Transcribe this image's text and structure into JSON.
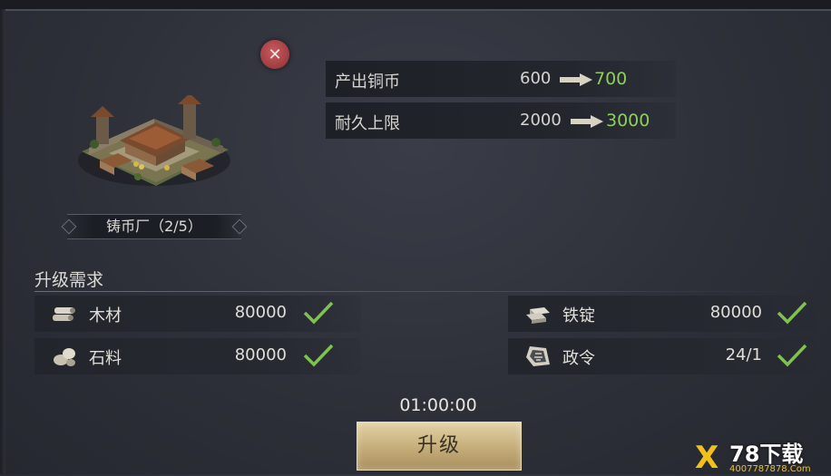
{
  "close_symbol": "✕",
  "building": {
    "name": "铸币厂（2/5）",
    "icon": "mint-building-icon"
  },
  "stats": [
    {
      "label": "产出铜币",
      "old": "600",
      "new": "700"
    },
    {
      "label": "耐久上限",
      "old": "2000",
      "new": "3000"
    }
  ],
  "requirements": {
    "title": "升级需求",
    "items": [
      {
        "name": "木材",
        "amount": "80000",
        "icon": "wood-icon",
        "met": true
      },
      {
        "name": "铁锭",
        "amount": "80000",
        "icon": "iron-ingot-icon",
        "met": true
      },
      {
        "name": "石料",
        "amount": "80000",
        "icon": "stone-icon",
        "met": true
      },
      {
        "name": "政令",
        "amount": "24/1",
        "icon": "decree-icon",
        "met": true
      }
    ]
  },
  "timer": "01:00:00",
  "upgrade_label": "升级",
  "watermark": {
    "x": "X",
    "title": "78下载",
    "sub": "4007787878.Com"
  },
  "colors": {
    "increase": "#8fcf5a",
    "check": "#7fc24e",
    "button": "#c8b07d",
    "close": "#b9474b"
  }
}
